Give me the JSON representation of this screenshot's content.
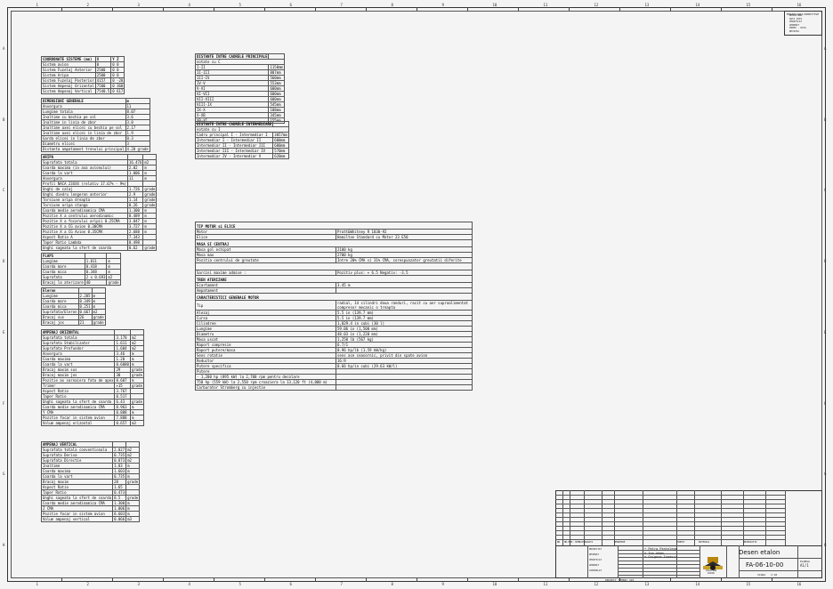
{
  "zones_top": [
    "1",
    "2",
    "3",
    "4",
    "5",
    "6",
    "7",
    "8",
    "9",
    "10",
    "11",
    "12",
    "13",
    "14",
    "15",
    "16"
  ],
  "zones_bottom": [
    "1",
    "2",
    "3",
    "4",
    "5",
    "6",
    "7",
    "8",
    "9",
    "10",
    "11",
    "12",
    "13",
    "14",
    "15",
    "16"
  ],
  "zones_side": [
    "A",
    "B",
    "C",
    "D",
    "E",
    "F",
    "G",
    "H"
  ],
  "revision_box": {
    "title": "MODIFICARI/DIRECTIVE",
    "lines": [
      "DESEN NOU",
      "DATA 2019",
      "VERIFICAT",
      "APROBAT",
      "INDEX - DATA",
      "REVIZIA"
    ]
  },
  "t1": {
    "header": [
      "COORDONATE SISTEME (mm)",
      "X",
      "Y Z"
    ],
    "rows": [
      [
        "Sistem avion",
        "0",
        "0 0"
      ],
      [
        "Sistem Fuzelaj Anterior",
        "2500",
        "0 0"
      ],
      [
        "Sistem Aripa",
        "2500",
        "0 0"
      ],
      [
        "Sistem Fuzelaj Posterior",
        "4157",
        "0 -28"
      ],
      [
        "Sistem Ampenaj Orizontal",
        "7500",
        "0 360"
      ],
      [
        "Sistem Ampenaj Vertical",
        "7540.5",
        "0 617"
      ]
    ]
  },
  "t2": {
    "header": [
      "DIMENSIUNI GENERALE",
      "m"
    ],
    "rows": [
      [
        "Anvergura",
        "11"
      ],
      [
        "Lungime totala",
        "8.07"
      ],
      [
        "Inaltime cu bechia pe sol",
        "3.6"
      ],
      [
        "Inaltime in linia de zbor",
        "3.0"
      ],
      [
        "Inaltime axei elicei cu bechia pe sol",
        "2.17"
      ],
      [
        "Inaltime axei elicei in linia de zbor",
        "1.9"
      ],
      [
        "Garda elicei in linia de zbor",
        "0.3"
      ],
      [
        "Diametru elicei",
        "3"
      ],
      [
        "Distanta ampatament trenului principal",
        "4.20 grade"
      ]
    ]
  },
  "t3": {
    "header": [
      "ARIPA",
      "",
      ""
    ],
    "rows": [
      [
        "Suprafata totala",
        "16.476",
        "m2"
      ],
      [
        "Coarda maxima (in axa avionului)",
        "2.02",
        "m"
      ],
      [
        "Coarda la vart",
        "1.006",
        "m"
      ],
      [
        "Anvergura",
        "11",
        "m"
      ],
      [
        "Profil NACA 23XXX (relativ 17.67% - 9%)",
        "",
        ""
      ],
      [
        "Unghi de calaj",
        "1.726",
        "grade"
      ],
      [
        "Unghi diedru longeron anterior",
        "2.9",
        "grade"
      ],
      [
        "Torsiune aripa dreapta",
        "1.14",
        "grade"
      ],
      [
        "Torsiune aripa stanga",
        "0.26",
        "grade"
      ],
      [
        "Coarda medie aerodinamica CMA",
        "1.300",
        "m"
      ],
      [
        "Pozitie X a centrului aerodinamic",
        "0.489",
        "m"
      ],
      [
        "Pozitie X a focarului aripii 0.25CMA",
        "3.847",
        "m"
      ],
      [
        "Pozitie X a CG avion 0.30CMA",
        "3.727",
        "m"
      ],
      [
        "Pozitie X a CG Avion 0.35CMA",
        "2.688",
        "m"
      ],
      [
        "Aspect Ratio A",
        "7.343",
        ""
      ],
      [
        "Taper Ratio Lambda",
        "0.498",
        ""
      ],
      [
        "Unghi sageata la sfert de coarda",
        "0.62",
        "grade"
      ]
    ]
  },
  "t4": {
    "header": [
      "FLAPS",
      "",
      ""
    ],
    "rows": [
      [
        "Lungime",
        "1.811",
        "m"
      ],
      [
        "Coarda mare",
        "0.418",
        "m"
      ],
      [
        "Coarda mica",
        "0.348",
        "m"
      ],
      [
        "Suprafata",
        "2 x 0.693",
        "m2"
      ],
      [
        "Bracaj la aterizare",
        "40",
        "grade"
      ]
    ]
  },
  "t5": {
    "header": [
      "Eleron",
      "",
      ""
    ],
    "rows": [
      [
        "Lungime",
        "2.205",
        "m"
      ],
      [
        "Coarda mare",
        "0.349",
        "m"
      ],
      [
        "Coarda mica",
        "0.251",
        "m"
      ],
      [
        "Suprafata/Eleron",
        "0.667",
        "m2"
      ],
      [
        "Bracaj sus",
        "26",
        "grade"
      ],
      [
        "Bracaj jos",
        "21",
        "grade"
      ]
    ]
  },
  "t6": {
    "header": [
      "AMPENAJ ORIZONTAL",
      "",
      ""
    ],
    "rows": [
      [
        "Suprafata totala",
        "3.178",
        "m2"
      ],
      [
        "Suprafata Stabilizator",
        "1.611",
        "m2"
      ],
      [
        "Suprafata Profundor",
        "1.604",
        "m2"
      ],
      [
        "Anvergura",
        "3.46",
        "m"
      ],
      [
        "Coarda maxima",
        "1.20",
        "m"
      ],
      [
        "Coarda la vart",
        "0.6080",
        "m"
      ],
      [
        "Bracaj maxim sus",
        "29",
        "grade"
      ],
      [
        "Bracaj maxim jos",
        "30",
        "grade"
      ],
      [
        "Pozitie ax sarnaiera fata de apex",
        "0.607",
        "m"
      ],
      [
        "Trimer",
        "+15",
        "grade"
      ],
      [
        "Aspect Ratio",
        "3.767",
        ""
      ],
      [
        "Taper Ratio",
        "0.517",
        ""
      ],
      [
        "Unghi sageata la sfert de coarda",
        "6.43",
        "grade"
      ],
      [
        "Coarda medie aerodinamica CMA",
        "0.963",
        "m"
      ],
      [
        "Y CMA",
        "0.808",
        "m"
      ],
      [
        "Pozitie focar in sistem avion",
        "7.888",
        "m"
      ],
      [
        "Volum ampenaj orizontal",
        "0.657",
        "m3"
      ]
    ]
  },
  "t7": {
    "header": [
      "AMPENAJ VERTICAL",
      "",
      ""
    ],
    "rows": [
      [
        "Suprafata totala conventionala",
        "2.027",
        "m2"
      ],
      [
        "Suprafata Deriva",
        "0.735",
        "m2"
      ],
      [
        "Suprafata Directie",
        "0.873",
        "m2"
      ],
      [
        "Inaltime",
        "1.83",
        "m"
      ],
      [
        "Coarda maxima",
        "1.603",
        "m"
      ],
      [
        "Coarda la vart",
        "0.735",
        "m"
      ],
      [
        "Bracaj maxim",
        "28",
        "grade"
      ],
      [
        "Aspect Ratio",
        "1.65",
        ""
      ],
      [
        "Taper Ratio",
        "0.473",
        ""
      ],
      [
        "Unghi sageata la sfert de coarda",
        "8.5",
        "grade"
      ],
      [
        "Coarda medie aerodinamica CMA",
        "1.300",
        "m"
      ],
      [
        "Z CMA",
        "1.006",
        "m"
      ],
      [
        "Pozitie focar in sistem avion",
        "8.603",
        "m"
      ],
      [
        "Volum ampenaj vertical",
        "0.066",
        "m3"
      ]
    ]
  },
  "t8": {
    "header": [
      "DISTANTE INTRE CADRELE PRINCIPALE",
      ""
    ],
    "subheader": "notate cu C",
    "rows": [
      [
        "I-II",
        "1150mm"
      ],
      [
        "II-III",
        "807mm"
      ],
      [
        "III-IV",
        "560mm"
      ],
      [
        "IV-V",
        "553mm"
      ],
      [
        "V-VI",
        "600mm"
      ],
      [
        "VI-VII",
        "600mm"
      ],
      [
        "VII-VIII",
        "600mm"
      ],
      [
        "VIII-IX",
        "545mm"
      ],
      [
        "IX-X",
        "108mm"
      ],
      [
        "X-XB",
        "345mm"
      ],
      [
        "XB-XI",
        "155mm"
      ]
    ]
  },
  "t9": {
    "header": [
      "DISTANTE INTRE CADRELE INTERMEDIARE",
      ""
    ],
    "subheader": "notate cu I",
    "rows": [
      [
        "Cadru principal I - Intermediar I",
        "3057mm"
      ],
      [
        "Intermediar I - Intermediar II",
        "600mm"
      ],
      [
        "Intermediar II - Intermediar III",
        "600mm"
      ],
      [
        "Intermediar III - Intermediar IV",
        "570mm"
      ],
      [
        "Intermediar IV - Intermediar V",
        "620mm"
      ]
    ]
  },
  "t10": {
    "sections": [
      {
        "header": "TIP MOTOR si ELICE",
        "rows": [
          [
            "Motor",
            "Pratt&Whitney R 1830-92"
          ],
          [
            "Elice",
            "Hamilton Standard cu Motor 23 E50"
          ]
        ]
      },
      {
        "header": "MASA SI CENTRAJ",
        "rows": [
          [
            "Masa gol echipat",
            "2100 kg"
          ],
          [
            "Masa max",
            "2700 kg"
          ],
          [
            "Pozitia centrului de greutate",
            "Intre  20% CMA si 31% CMA, corespunzator greutatii  diferite"
          ]
        ]
      },
      {
        "header": "",
        "rows": [
          [
            "Sarcini maxime admise :",
            "Pozitiv plus: + 6.5   Negativ: -3.5"
          ]
        ]
      },
      {
        "header": "TREN ATERIZARE",
        "rows": [
          [
            "Ecartament",
            "3.45 m"
          ],
          [
            "Ampatament",
            ""
          ]
        ]
      },
      {
        "header": "CARACTERISTICI GENERALE MOTOR",
        "rows": [
          [
            "Tip",
            "radial, 14 cilindri doua randuri, racit cu aer supraalimentat compresor mecanic o treapta"
          ],
          [
            "Alezaj",
            "5.5 in (139.7 mm)"
          ],
          [
            "Cursa",
            "5.5 in (139.7 mm)"
          ],
          [
            "Cilindree",
            "1,829.4 in cubi (30 l)"
          ],
          [
            "Lungime",
            "59.06 in (1,500 mm)"
          ],
          [
            "Diametru",
            "48.03 in (1,220 mm)"
          ],
          [
            "Masa uscat",
            "1,250 lb (567 kg)"
          ],
          [
            "Raport compresie",
            "6.7/1"
          ],
          [
            "Raport putere/masa",
            "0.96 hp/lb (1.59 kW/kg)"
          ],
          [
            "Sens rotatie",
            "sens ace ceasornic, privit din spate avion"
          ],
          [
            "Reductor",
            "16:9"
          ],
          [
            "Putere specifica",
            "0.66 hp/in cubi (29.63 kW/l)"
          ],
          [
            "Putere",
            ""
          ],
          [
            "- 1,200 hp (895 kW) la 2,700 rpm pentru decolare",
            ""
          ],
          [
            "  750 hp (559 kW) la 2,550 rpm croaziera la 13,120 ft (4,000 m)",
            ""
          ],
          [
            "Carburator Stromberg cu injectie",
            ""
          ]
        ]
      }
    ]
  },
  "title_block": {
    "title": "Desen etalon",
    "code": "FA-06-10-00",
    "sheet_label": "PLANSA",
    "sheet": "A1/1",
    "scale_label": "SCARA",
    "scale": "1:10",
    "names": [
      "Petra Pentelego",
      "Ion Adam",
      "Grigore Ionescu"
    ],
    "roles": [
      "PROIECTAT",
      "DESENAT",
      "VERIFICAT",
      "APROBAT",
      "CONTROLAT"
    ],
    "header_cells": [
      "NR",
      "NR.MOD.",
      "SEMNATURA",
      "DATA",
      "DENUMIRE",
      "FORMAT",
      "MATERIAL",
      "OBSERVATII"
    ],
    "stamp_top": "AVIATION",
    "stamp_bottom": "AVION",
    "bottom_note": "PROIECT TEHNIC SP1"
  }
}
